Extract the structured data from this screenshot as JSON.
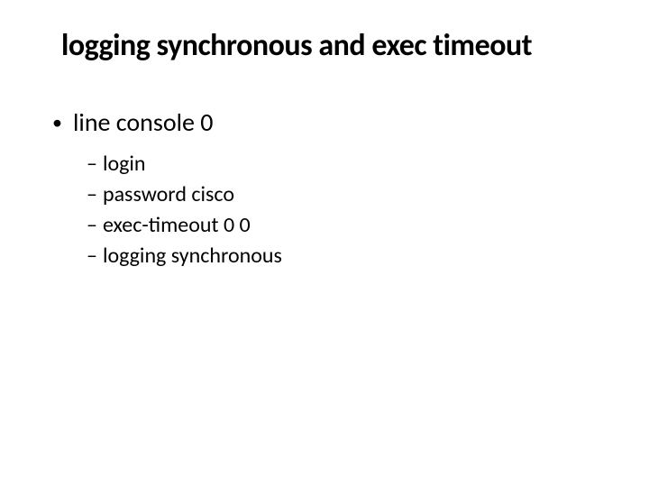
{
  "title": "logging synchronous and exec  timeout",
  "bullets": [
    {
      "text": "line console 0",
      "children": [
        {
          "text": "login"
        },
        {
          "text": "password cisco"
        },
        {
          "text": "exec-timeout 0 0"
        },
        {
          "text": "logging synchronous"
        }
      ]
    }
  ]
}
